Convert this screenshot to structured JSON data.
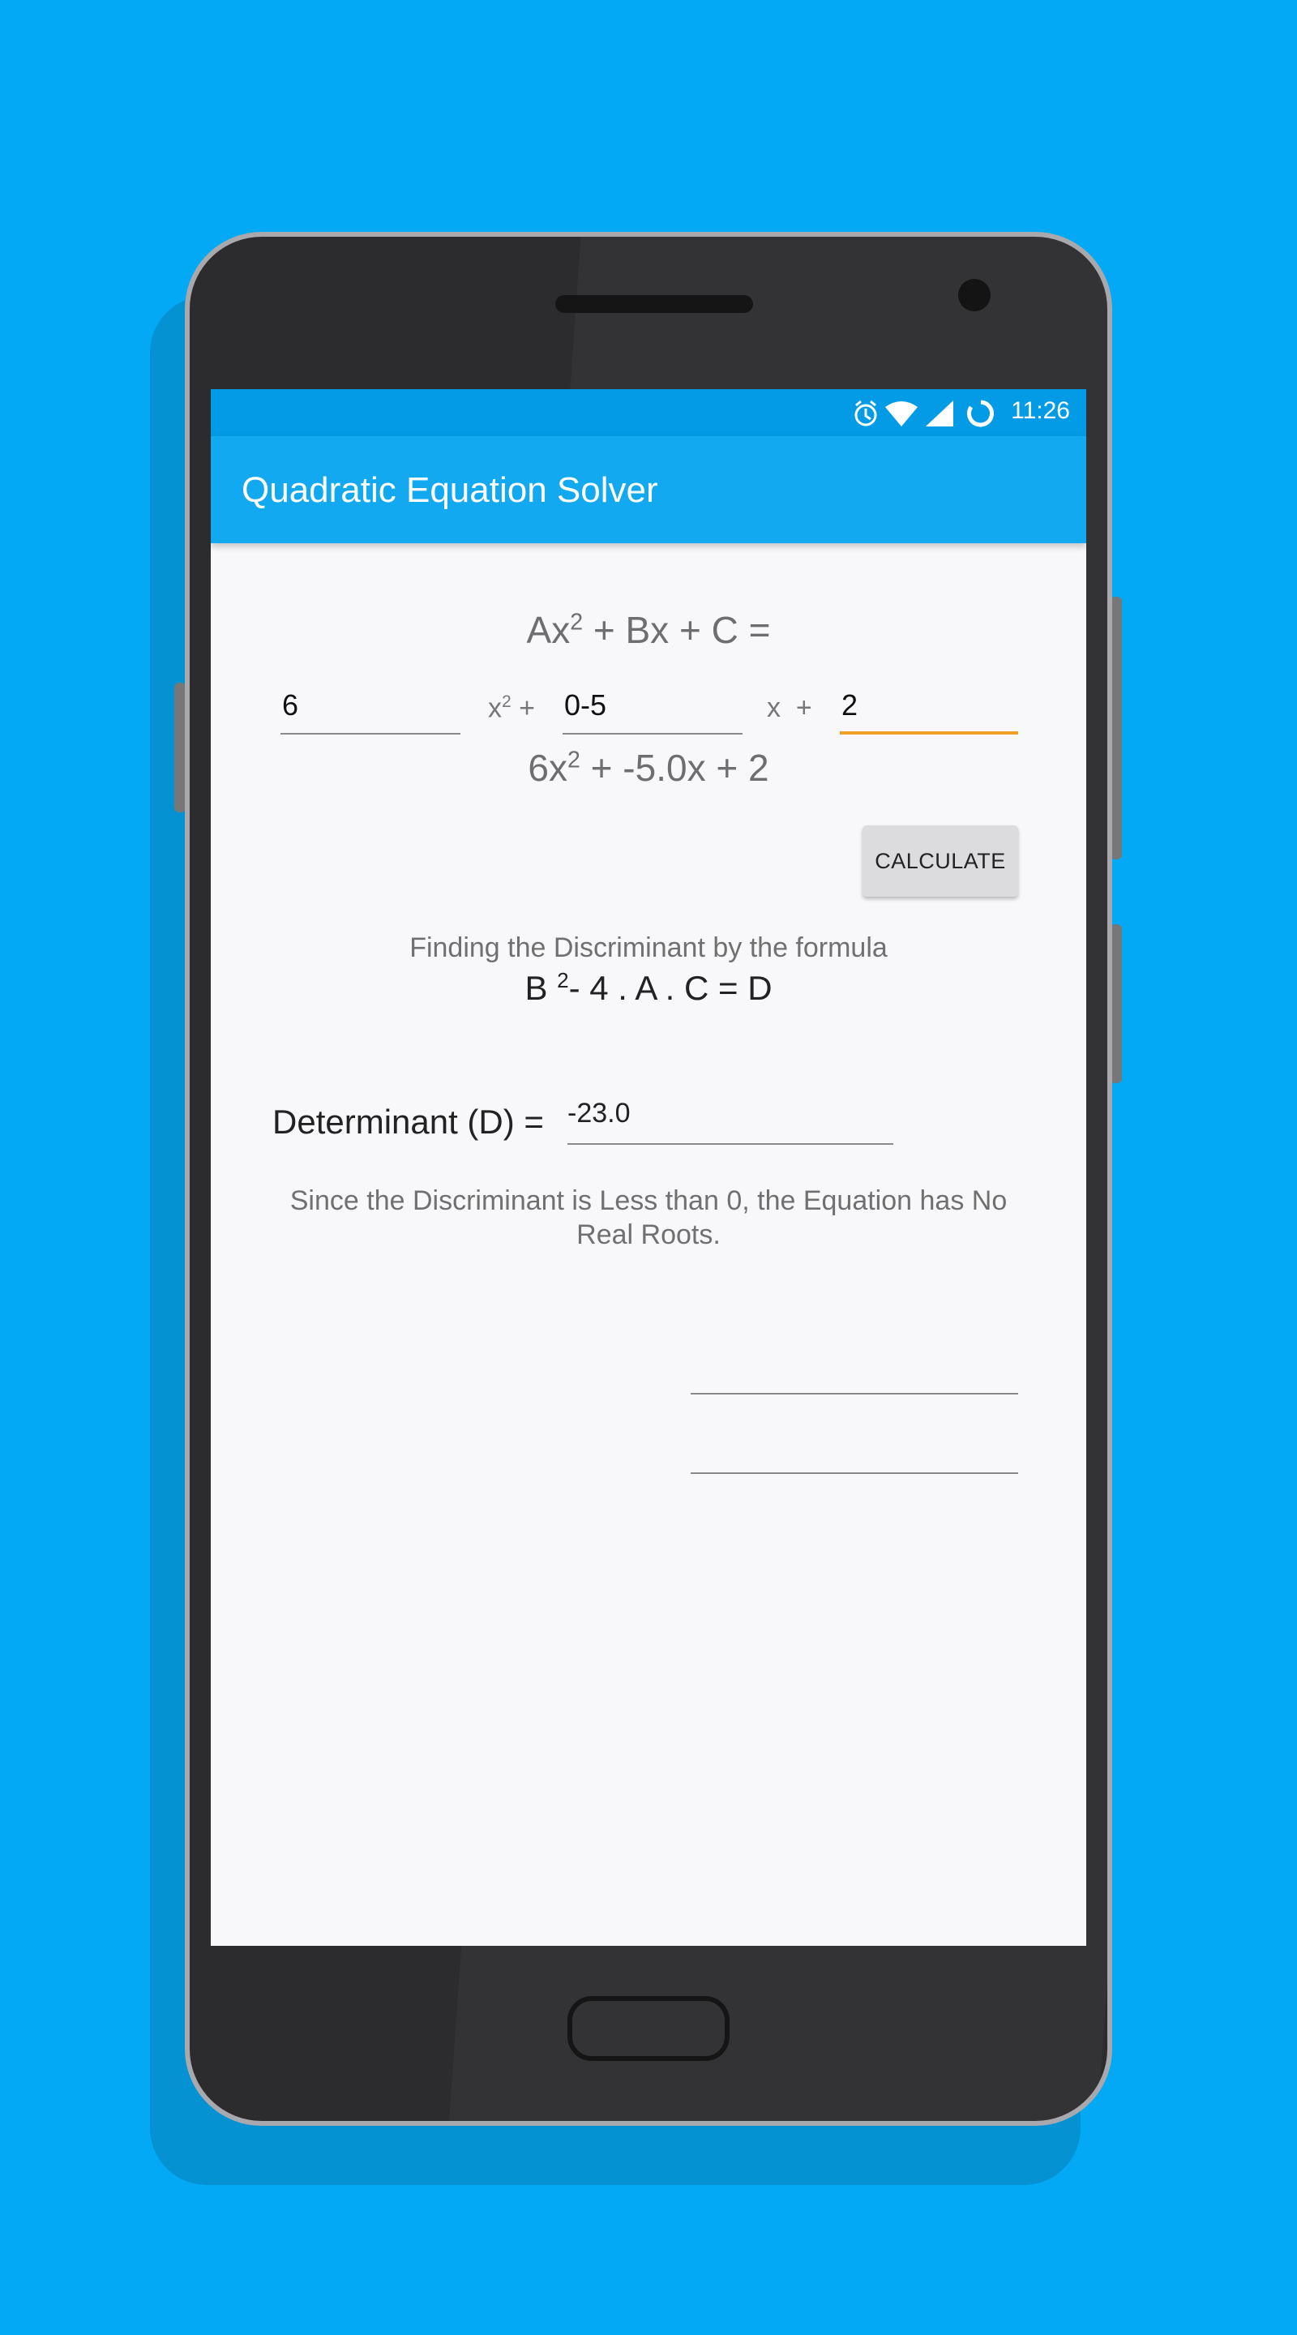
{
  "status_bar": {
    "time": "11:26",
    "icons": [
      "alarm-icon",
      "wifi-icon",
      "signal-icon",
      "sync-icon"
    ]
  },
  "app_bar": {
    "title": "Quadratic Equation Solver"
  },
  "equation_general": {
    "a": "Ax",
    "exp": "2",
    "rest": " + Bx + C ="
  },
  "inputs": {
    "a_value": "6",
    "b_value": "0-5",
    "c_value": "2",
    "x2_label": "x",
    "x2_exp": "2",
    "x2_plus": " +",
    "x_label": "x  +"
  },
  "equation_display": {
    "lead": "6x",
    "exp": "2",
    "rest": " + -5.0x + 2"
  },
  "buttons": {
    "calculate": "CALCULATE"
  },
  "discriminant": {
    "finding_text": "Finding the Discriminant by the formula",
    "formula_b": "B ",
    "formula_exp": "2",
    "formula_rest": "- 4 . A . C = D",
    "label": "Determinant (D) =",
    "value": "-23.0",
    "conclusion": "Since the Discriminant is Less than 0, the Equation has No Real Roots."
  },
  "colors": {
    "background": "#03A9F4",
    "app_bar": "#12A9F1",
    "status_bar": "#039BE5",
    "focus_underline": "#F0A024"
  }
}
